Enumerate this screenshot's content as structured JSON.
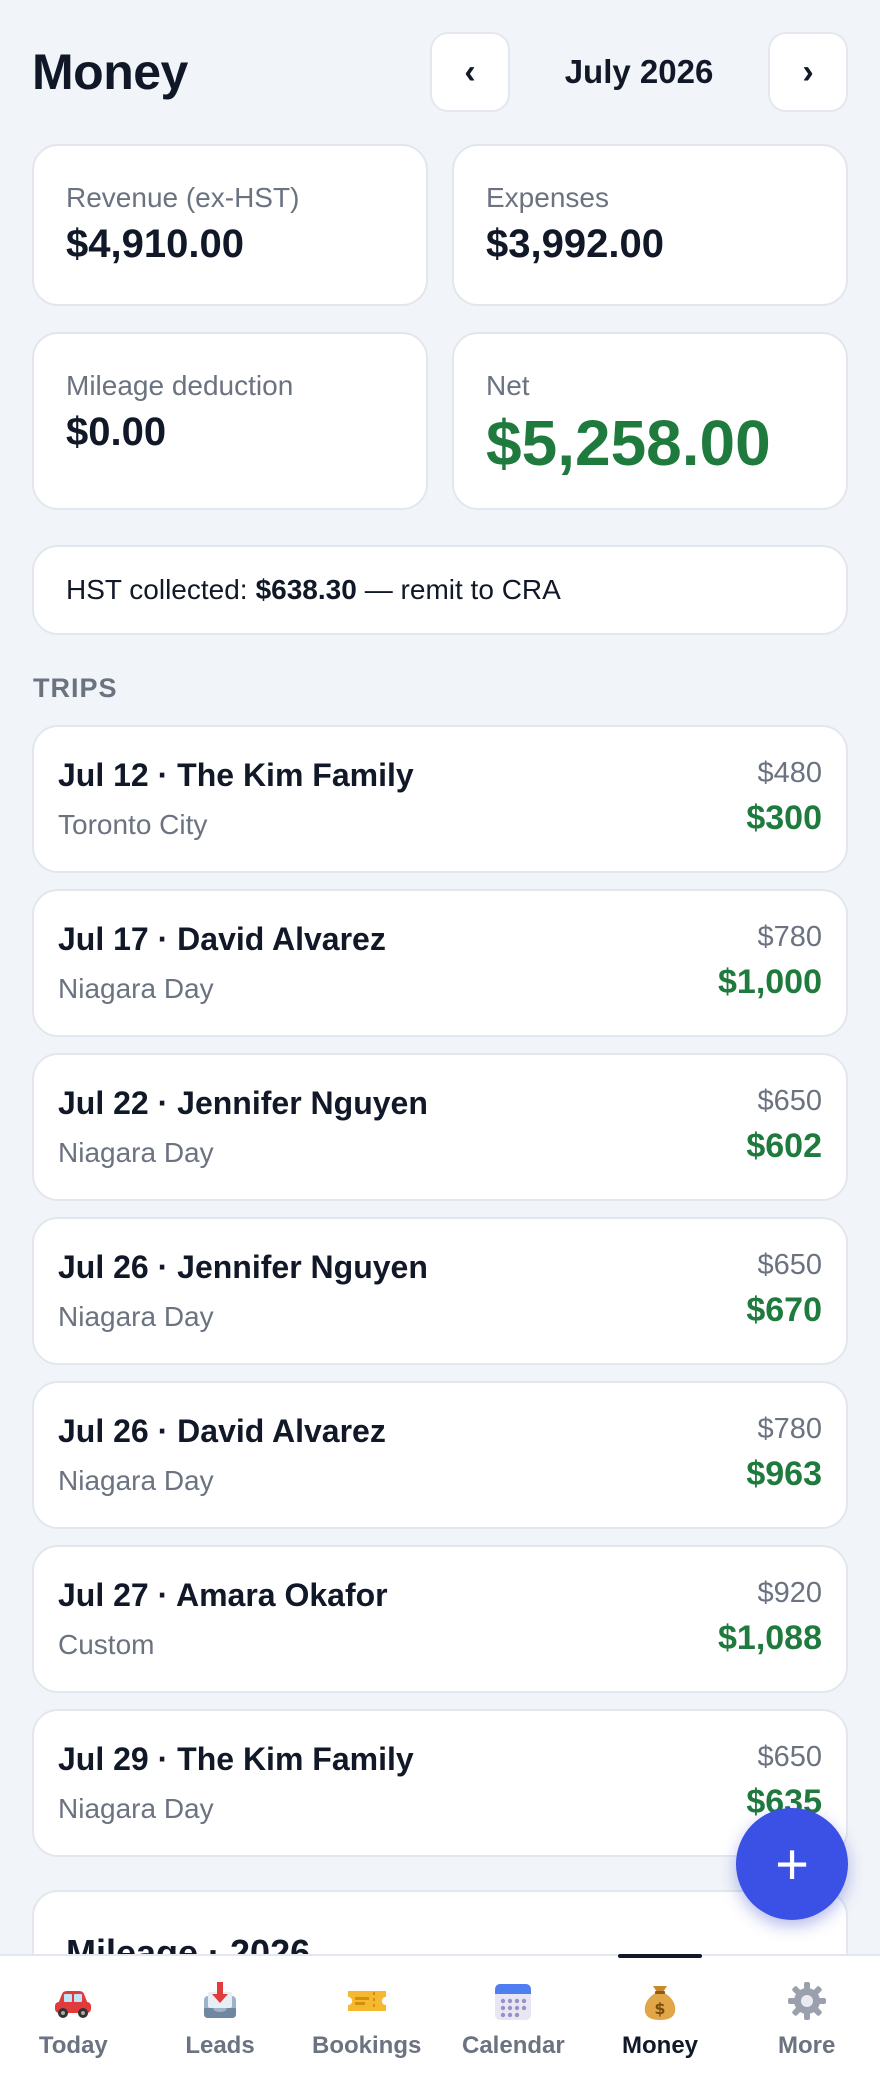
{
  "header": {
    "title": "Money",
    "month": "July 2026",
    "prev": "‹",
    "next": "›"
  },
  "stats": {
    "revenue": {
      "label": "Revenue (ex-HST)",
      "value": "$4,910.00"
    },
    "expenses": {
      "label": "Expenses",
      "value": "$3,992.00"
    },
    "mileage": {
      "label": "Mileage deduction",
      "value": "$0.00"
    },
    "net": {
      "label": "Net",
      "value": "$5,258.00"
    }
  },
  "hst": {
    "prefix": "HST collected:",
    "amount": "$638.30",
    "suffix": "— remit to CRA"
  },
  "trips_title": "TRIPS",
  "trips": [
    {
      "title": "Jul 12 · The Kim Family",
      "sub": "Toronto City",
      "price": "$480",
      "net": "$300"
    },
    {
      "title": "Jul 17 · David Alvarez",
      "sub": "Niagara Day",
      "price": "$780",
      "net": "$1,000"
    },
    {
      "title": "Jul 22 · Jennifer Nguyen",
      "sub": "Niagara Day",
      "price": "$650",
      "net": "$602"
    },
    {
      "title": "Jul 26 · Jennifer Nguyen",
      "sub": "Niagara Day",
      "price": "$650",
      "net": "$670"
    },
    {
      "title": "Jul 26 · David Alvarez",
      "sub": "Niagara Day",
      "price": "$780",
      "net": "$963"
    },
    {
      "title": "Jul 27 · Amara Okafor",
      "sub": "Custom",
      "price": "$920",
      "net": "$1,088"
    },
    {
      "title": "Jul 29 · The Kim Family",
      "sub": "Niagara Day",
      "price": "$650",
      "net": "$635"
    }
  ],
  "mileage_title": "Mileage · 2026",
  "fab": "+",
  "tabs": [
    {
      "label": "Today",
      "icon": "car-icon"
    },
    {
      "label": "Leads",
      "icon": "inbox-icon"
    },
    {
      "label": "Bookings",
      "icon": "ticket-icon"
    },
    {
      "label": "Calendar",
      "icon": "calendar-icon"
    },
    {
      "label": "Money",
      "icon": "money-bag-icon",
      "active": true
    },
    {
      "label": "More",
      "icon": "gear-icon"
    }
  ],
  "colors": {
    "accent": "#3b50e4",
    "positive": "#1f7a3d",
    "muted": "#6b7280",
    "background": "#f1f4f8"
  }
}
